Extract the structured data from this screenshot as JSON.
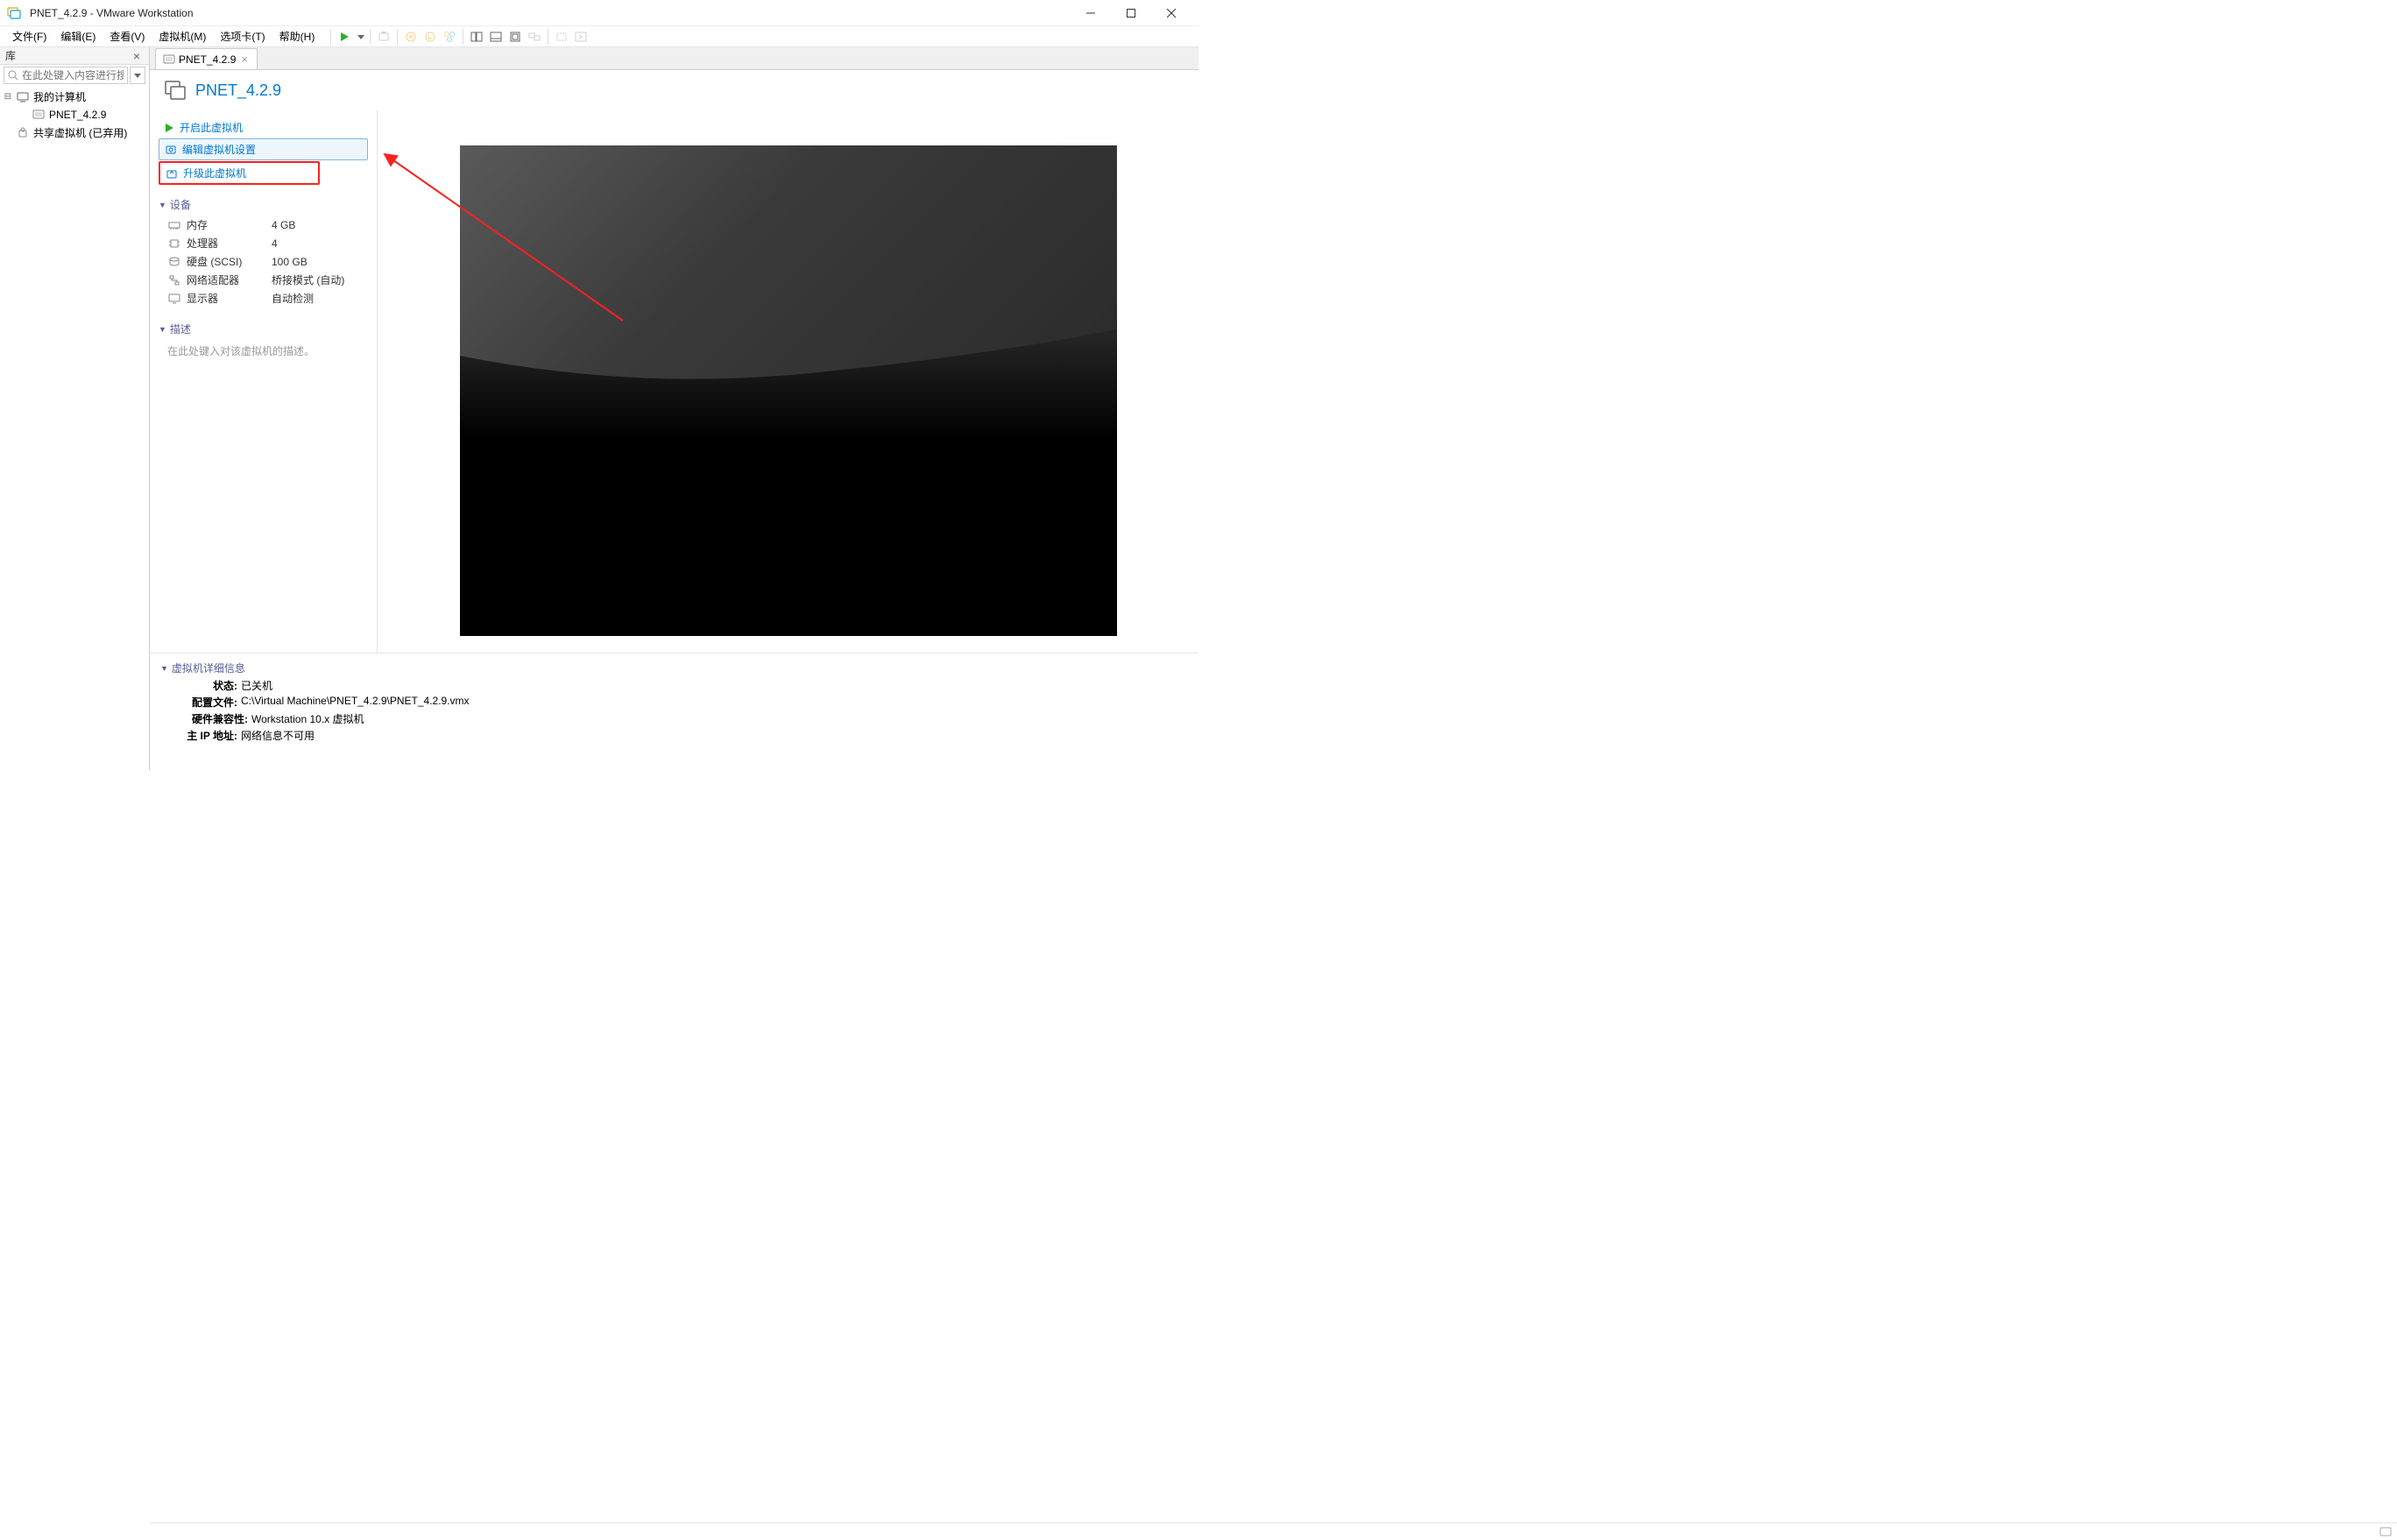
{
  "window_title": "PNET_4.2.9 - VMware Workstation",
  "menu": {
    "file": "文件(F)",
    "edit": "编辑(E)",
    "view": "查看(V)",
    "vm": "虚拟机(M)",
    "tabs": "选项卡(T)",
    "help": "帮助(H)"
  },
  "sidebar": {
    "title": "库",
    "search_placeholder": "在此处键入内容进行搜索",
    "my_computer": "我的计算机",
    "vm1": "PNET_4.2.9",
    "shared": "共享虚拟机 (已弃用)"
  },
  "tab": {
    "label": "PNET_4.2.9"
  },
  "vm_title": "PNET_4.2.9",
  "actions": {
    "power_on": "开启此虚拟机",
    "edit_settings": "编辑虚拟机设置",
    "upgrade": "升级此虚拟机"
  },
  "devices": {
    "title": "设备",
    "memory": {
      "label": "内存",
      "value": "4 GB"
    },
    "processor": {
      "label": "处理器",
      "value": "4"
    },
    "disk": {
      "label": "硬盘 (SCSI)",
      "value": "100 GB"
    },
    "network": {
      "label": "网络适配器",
      "value": "桥接模式 (自动)"
    },
    "display": {
      "label": "显示器",
      "value": "自动检测"
    }
  },
  "description": {
    "title": "描述",
    "placeholder": "在此处键入对该虚拟机的描述。"
  },
  "details": {
    "title": "虚拟机详细信息",
    "state": {
      "label": "状态:",
      "value": "已关机"
    },
    "config": {
      "label": "配置文件:",
      "value": "C:\\Virtual Machine\\PNET_4.2.9\\PNET_4.2.9.vmx"
    },
    "compat": {
      "label": "硬件兼容性:",
      "value": "Workstation 10.x 虚拟机"
    },
    "ip": {
      "label": "主 IP 地址:",
      "value": "网络信息不可用"
    }
  }
}
